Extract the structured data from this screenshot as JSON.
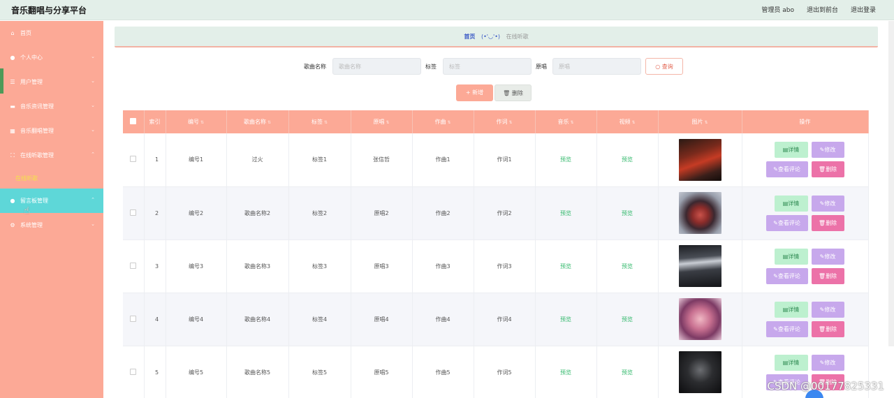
{
  "app": {
    "title": "音乐翻唱与分享平台"
  },
  "topbar": {
    "user": "管理员 abo",
    "back_link": "退出到前台",
    "logout": "退出登录"
  },
  "sidebar": {
    "items": [
      {
        "label": "首页",
        "icon": "home-icon",
        "has_children": false
      },
      {
        "label": "个人中心",
        "icon": "user-icon",
        "has_children": true
      },
      {
        "label": "用户管理",
        "icon": "list-icon",
        "has_children": true
      },
      {
        "label": "音乐资讯管理",
        "icon": "news-icon",
        "has_children": true
      },
      {
        "label": "音乐翻唱管理",
        "icon": "grid-icon",
        "has_children": true
      },
      {
        "label": "在线听歌管理",
        "icon": "focus-icon",
        "has_children": true,
        "sub": [
          "在线听歌"
        ]
      },
      {
        "label": "留言板管理",
        "icon": "user-icon",
        "has_children": true,
        "active": true
      },
      {
        "label": "系统管理",
        "icon": "gear-icon",
        "has_children": true
      }
    ]
  },
  "breadcrumb": {
    "home": "首页",
    "face": "(•'◡'•)",
    "current": "在线听歌"
  },
  "search": {
    "song_label": "歌曲名称",
    "song_placeholder": "歌曲名称",
    "tag_label": "标签",
    "tag_placeholder": "标签",
    "singer_label": "原唱",
    "singer_placeholder": "原唱",
    "query_label": "查询"
  },
  "actions": {
    "add": "新增",
    "delete": "删除"
  },
  "table": {
    "headers": [
      "索引",
      "编号",
      "歌曲名称",
      "标签",
      "原唱",
      "作曲",
      "作词",
      "音乐",
      "视频",
      "图片",
      "操作"
    ],
    "rows": [
      {
        "index": "1",
        "code": "编号1",
        "song": "过火",
        "tag": "标签1",
        "singer": "张信哲",
        "composer": "作曲1",
        "lyricist": "作词1",
        "music": "预览",
        "video": "预览"
      },
      {
        "index": "2",
        "code": "编号2",
        "song": "歌曲名称2",
        "tag": "标签2",
        "singer": "原唱2",
        "composer": "作曲2",
        "lyricist": "作词2",
        "music": "预览",
        "video": "预览"
      },
      {
        "index": "3",
        "code": "编号3",
        "song": "歌曲名称3",
        "tag": "标签3",
        "singer": "原唱3",
        "composer": "作曲3",
        "lyricist": "作词3",
        "music": "预览",
        "video": "预览"
      },
      {
        "index": "4",
        "code": "编号4",
        "song": "歌曲名称4",
        "tag": "标签4",
        "singer": "原唱4",
        "composer": "作曲4",
        "lyricist": "作词4",
        "music": "预览",
        "video": "预览"
      },
      {
        "index": "5",
        "code": "编号5",
        "song": "歌曲名称5",
        "tag": "标签5",
        "singer": "原唱5",
        "composer": "作曲5",
        "lyricist": "作词5",
        "music": "预览",
        "video": "预览"
      }
    ],
    "ops": {
      "detail": "详情",
      "edit": "修改",
      "comments": "查看评论",
      "remove": "删除"
    }
  },
  "watermark": "CSDN @00177825331",
  "colors": {
    "accent": "#fca996",
    "active": "#5ed7d8",
    "topbar": "#e3efe9",
    "preview": "#32b86b",
    "remove": "#ec72a8",
    "purple": "#c7a8ec"
  }
}
